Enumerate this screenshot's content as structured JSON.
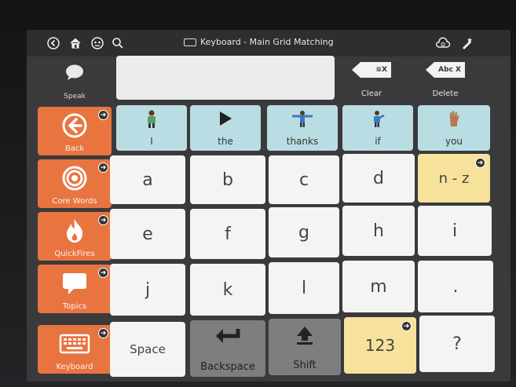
{
  "title": "Keyboard - Main Grid Matching",
  "toolbar": {
    "speak_label": "Speak",
    "clear_label": "Clear",
    "clear_tag": "≡X",
    "delete_label": "Delete",
    "delete_tag": "Abc X"
  },
  "message": {
    "value": ""
  },
  "sidebar": {
    "items": [
      {
        "label": "Back",
        "icon": "back-arrow-icon"
      },
      {
        "label": "Core Words",
        "icon": "target-icon"
      },
      {
        "label": "QuickFires",
        "icon": "fire-icon"
      },
      {
        "label": "Topics",
        "icon": "speech-bubble-icon"
      },
      {
        "label": "Keyboard",
        "icon": "keyboard-icon"
      }
    ]
  },
  "words": [
    {
      "label": "I",
      "icon": "person-icon"
    },
    {
      "label": "the",
      "icon": "triangle-icon"
    },
    {
      "label": "thanks",
      "icon": "person-arms-icon"
    },
    {
      "label": "if",
      "icon": "person-point-icon"
    },
    {
      "label": "you",
      "icon": "hand-icon"
    }
  ],
  "keys": {
    "row1": [
      "a",
      "b",
      "c",
      "d",
      "n - z"
    ],
    "row2": [
      "e",
      "f",
      "g",
      "h",
      "i"
    ],
    "row3": [
      "j",
      "k",
      "l",
      "m",
      "."
    ],
    "row4": [
      "Space",
      "Backspace",
      "Shift",
      "123",
      "?"
    ]
  },
  "colors": {
    "sidebar": "#e8743f",
    "word_cell": "#b9dde2",
    "letter_cell": "#f4f4f2",
    "nav_cell": "#f6e29b",
    "control_cell": "#7c7e80"
  }
}
